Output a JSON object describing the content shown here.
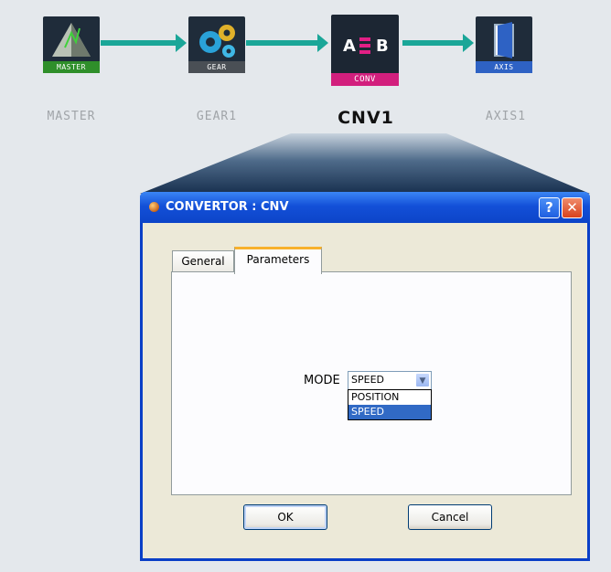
{
  "chain": {
    "nodes": [
      {
        "badge": "MASTER",
        "label": "MASTER",
        "active": false,
        "badge_color": "#2f8f2a",
        "icon": "pyramid-icon"
      },
      {
        "badge": "GEAR",
        "label": "GEAR1",
        "active": false,
        "badge_color": "#4a4f55",
        "icon": "gears-icon"
      },
      {
        "badge": "CONV",
        "label": "CNV1",
        "active": true,
        "badge_color": "#d21f7d",
        "icon": "convert-icon",
        "art_left": "A",
        "art_right": "B"
      },
      {
        "badge": "AXIS",
        "label": "AXIS1",
        "active": false,
        "badge_color": "#2e62c4",
        "icon": "door-icon"
      }
    ],
    "arrow_color": "#1aa698"
  },
  "dialog": {
    "title": "CONVERTOR : CNV",
    "help_glyph": "?",
    "close_glyph": "✕",
    "tabs": [
      "General",
      "Parameters"
    ],
    "active_tab": "Parameters",
    "mode": {
      "label": "MODE",
      "value": "SPEED",
      "options": [
        "POSITION",
        "SPEED"
      ],
      "selected_option": "SPEED"
    },
    "ok_label": "OK",
    "cancel_label": "Cancel"
  },
  "colors": {
    "titlebar": "#0c44c8",
    "tab_highlight": "#f7b12c",
    "selection": "#316ac5"
  }
}
